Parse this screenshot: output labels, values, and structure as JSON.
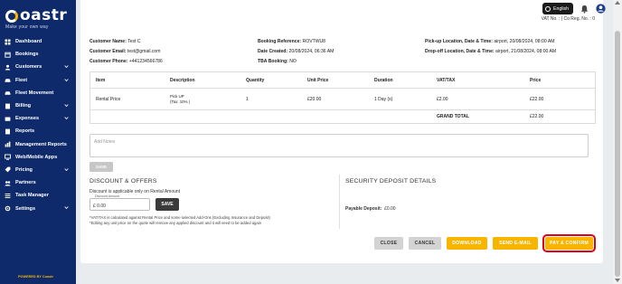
{
  "app": {
    "brand": "oastr",
    "tagline": "Make your own way",
    "powered_by": "POWERED BY Coastr"
  },
  "sidebar": {
    "items": [
      {
        "label": "Dashboard",
        "icon": "dashboard-icon",
        "has_children": false
      },
      {
        "label": "Bookings",
        "icon": "bookings-icon",
        "has_children": false
      },
      {
        "label": "Customers",
        "icon": "customers-icon",
        "has_children": true
      },
      {
        "label": "Fleet",
        "icon": "fleet-icon",
        "has_children": true
      },
      {
        "label": "Fleet Movement",
        "icon": "fleet-movement-icon",
        "has_children": false
      },
      {
        "label": "Billing",
        "icon": "billing-icon",
        "has_children": true
      },
      {
        "label": "Expenses",
        "icon": "expenses-icon",
        "has_children": true
      },
      {
        "label": "Reports",
        "icon": "reports-icon",
        "has_children": false
      },
      {
        "label": "Management Reports",
        "icon": "management-reports-icon",
        "has_children": false
      },
      {
        "label": "Web/Mobile Apps",
        "icon": "web-mobile-apps-icon",
        "has_children": false
      },
      {
        "label": "Pricing",
        "icon": "pricing-icon",
        "has_children": true
      },
      {
        "label": "Partners",
        "icon": "partners-icon",
        "has_children": false
      },
      {
        "label": "Task Manager",
        "icon": "task-manager-icon",
        "has_children": false
      },
      {
        "label": "Settings",
        "icon": "settings-icon",
        "has_children": true
      }
    ]
  },
  "topbar": {
    "language": "English",
    "vat_line": "VAT No. : | Co Reg. No. : 0"
  },
  "booking": {
    "customer_name_label": "Customer Name:",
    "customer_name": "Test C",
    "customer_email_label": "Customer Email:",
    "customer_email": "test@gmail.com",
    "customer_phone_label": "Customer Phone:",
    "customer_phone": "+441234566786",
    "reference_label": "Booking Reference:",
    "reference": "ROVTWU8",
    "date_created_label": "Date Created:",
    "date_created": "20/08/2024, 06:36 AM",
    "tba_label": "TBA Booking:",
    "tba": "NO",
    "pickup_label": "Pick-up Location, Date & Time:",
    "pickup": "airport, 20/08/2024, 08:00 AM",
    "dropoff_label": "Drop-off Location, Date & Time:",
    "dropoff": "airport, 21/08/2024, 08:00 AM"
  },
  "table": {
    "headers": [
      "Item",
      "Description",
      "Quantity",
      "Unit Price",
      "Duration",
      "VAT/TAX",
      "Price"
    ],
    "row": {
      "item": "Rental Price",
      "description_1": "Pick UP",
      "description_2": "(Tax: 10% )",
      "quantity": "1",
      "unit_price": "£20.00",
      "duration": "1 Day (s)",
      "vat": "£2.00",
      "price": "£22.00"
    },
    "grand_total_label": "GRAND TOTAL",
    "grand_total": "£22.00"
  },
  "notes": {
    "placeholder": "Add Notes",
    "save_label": "SAVE"
  },
  "discount": {
    "title": "DISCOUNT & OFFERS",
    "subtitle": "Discount is applicable only on Rental Amount",
    "input_legend": "Discount Amount",
    "input_value": "£ 0.00",
    "save_label": "SAVE",
    "note_1": "*VAT/TAX is calculated against Rental Price and some selected Add-Ons (Excluding Insurance and Deposit)",
    "note_2": "*Editing any unit price on the quote will remove any applied discount and it will need to be added again"
  },
  "deposit": {
    "title": "SECURITY DEPOSIT DETAILS",
    "payable_label": "Payable Deposit:",
    "payable_value": "£0.00"
  },
  "actions": {
    "close": "CLOSE",
    "cancel": "CANCEL",
    "download": "DOWNLOAD",
    "send_email": "SEND E-MAIL",
    "pay_confirm": "PAY & CONFIRM"
  },
  "colors": {
    "sidebar_bg": "#0e2a6b",
    "accent_yellow": "#f7b500",
    "highlight_red": "#e0001a"
  }
}
